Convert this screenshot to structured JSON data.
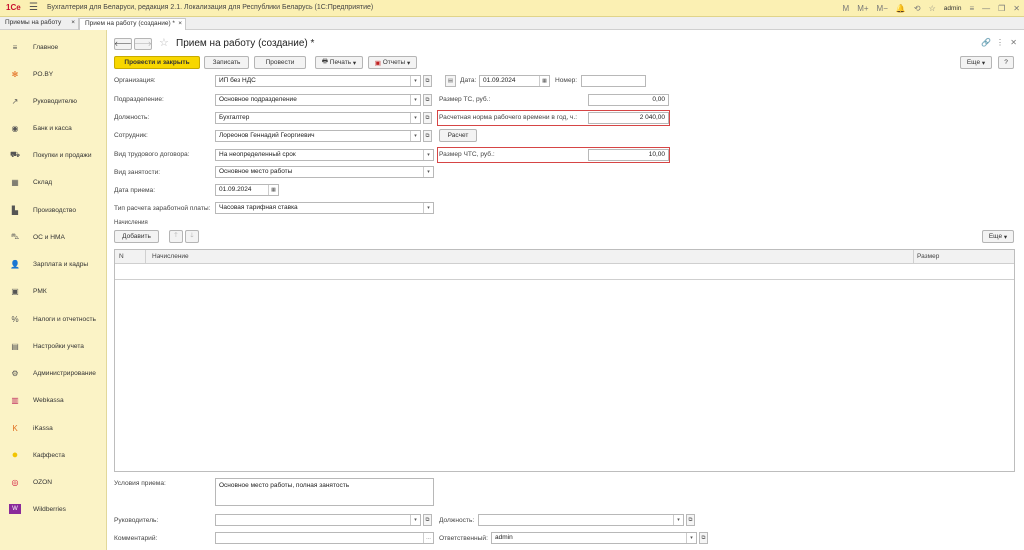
{
  "titlebar": {
    "logo": "1Сe",
    "title": "Бухгалтерия для Беларуси, редакция 2.1. Локализация для Республики Беларусь   (1С:Предприятие)",
    "user": "admin"
  },
  "tabs": [
    {
      "label": "Приемы на работу",
      "close": "×"
    },
    {
      "label": "Прием на работу (создание) *",
      "close": "×"
    }
  ],
  "sidebar": {
    "items": [
      {
        "label": "Главное",
        "icon": "≡"
      },
      {
        "label": "PO.BY",
        "icon": "✻"
      },
      {
        "label": "Руководителю",
        "icon": "↗"
      },
      {
        "label": "Банк и касса",
        "icon": "◉"
      },
      {
        "label": "Покупки и продажи",
        "icon": "⛟"
      },
      {
        "label": "Склад",
        "icon": "▦"
      },
      {
        "label": "Производство",
        "icon": "▙"
      },
      {
        "label": "ОС и НМА",
        "icon": "⛍"
      },
      {
        "label": "Зарплата и кадры",
        "icon": "👤"
      },
      {
        "label": "РМК",
        "icon": "▣"
      },
      {
        "label": "Налоги и отчетность",
        "icon": "%"
      },
      {
        "label": "Настройки учета",
        "icon": "▤"
      },
      {
        "label": "Администрирование",
        "icon": "⚙"
      },
      {
        "label": "Webkassa",
        "icon": "▥"
      },
      {
        "label": "iKassa",
        "icon": "K"
      },
      {
        "label": "Каффеста",
        "icon": "●"
      },
      {
        "label": "OZON",
        "icon": "◎"
      },
      {
        "label": "Wildberries",
        "icon": "W"
      }
    ]
  },
  "form": {
    "title": "Прием на работу (создание) *",
    "buttons": {
      "post_close": "Провести и закрыть",
      "save": "Записать",
      "post": "Провести",
      "print": "Печать",
      "reports": "Отчеты",
      "more": "Еще",
      "help": "?"
    },
    "fields": {
      "org_label": "Организация:",
      "org_value": "ИП без НДС",
      "date_label": "Дата:",
      "date_value": "01.09.2024",
      "number_label": "Номер:",
      "number_value": "",
      "dept_label": "Подразделение:",
      "dept_value": "Основное подразделение",
      "ts_label": "Размер ТС, руб.:",
      "ts_value": "0,00",
      "position_label": "Должность:",
      "position_value": "Бухгалтер",
      "norm_label": "Расчетная норма рабочего времени в год, ч.:",
      "norm_value": "2 040,00",
      "employee_label": "Сотрудник:",
      "employee_value": "Лореонов Геннадий Георгиевич",
      "calc_button": "Расчет",
      "contract_label": "Вид трудового договора:",
      "contract_value": "На неопределенный срок",
      "chts_label": "Размер ЧТС, руб.:",
      "chts_value": "10,00",
      "employment_label": "Вид занятости:",
      "employment_value": "Основное место работы",
      "hire_date_label": "Дата приема:",
      "hire_date_value": "01.09.2024",
      "pay_type_label": "Тип расчета заработной платы:",
      "pay_type_value": "Часовая тарифная ставка"
    },
    "accruals": {
      "section_label": "Начисления",
      "add_button": "Добавить",
      "more_button": "Еще",
      "columns": [
        "N",
        "Начисление",
        "Размер"
      ]
    },
    "bottom": {
      "conditions_label": "Условия приема:",
      "conditions_value": "Основное место работы, полная занятость",
      "manager_label": "Руководитель:",
      "manager_value": "",
      "manager_position_label": "Должность:",
      "manager_position_value": "",
      "comment_label": "Комментарий:",
      "comment_value": "",
      "responsible_label": "Ответственный:",
      "responsible_value": "admin"
    }
  },
  "colors": {
    "accent_yellow": "#f8d700",
    "sidebar_bg": "#fbf3c6",
    "highlight_red": "#d64545"
  }
}
